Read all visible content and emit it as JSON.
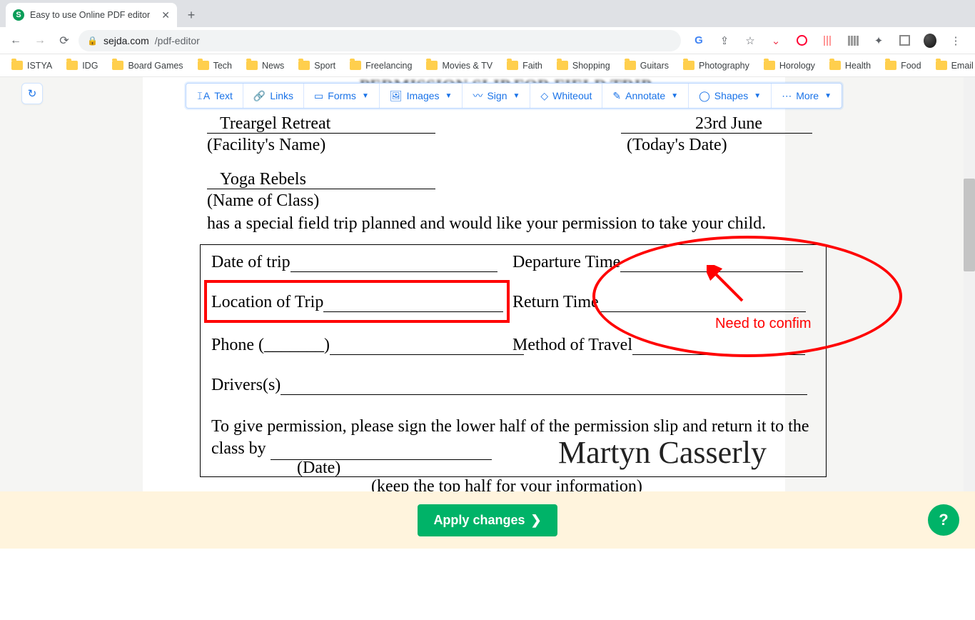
{
  "browser": {
    "tab_title": "Easy to use Online PDF editor",
    "url_host": "sejda.com",
    "url_path": "/pdf-editor",
    "bookmarks": [
      "ISTYA",
      "IDG",
      "Board Games",
      "Tech",
      "News",
      "Sport",
      "Freelancing",
      "Movies & TV",
      "Faith",
      "Shopping",
      "Guitars",
      "Photography",
      "Horology",
      "Health",
      "Food",
      "Email"
    ],
    "bm_more": "»"
  },
  "toolbar": {
    "text": "Text",
    "links": "Links",
    "forms": "Forms",
    "images": "Images",
    "sign": "Sign",
    "whiteout": "Whiteout",
    "annotate": "Annotate",
    "shapes": "Shapes",
    "more": "More"
  },
  "doc": {
    "title": "PERMISSION SLIP FOR FIELD TRIP",
    "facility_value": "Treargel Retreat",
    "facility_label": "(Facility's Name)",
    "date_value": "23rd June",
    "date_label": "(Today's Date)",
    "class_value": "Yoga Rebels",
    "class_label": "(Name of Class)",
    "body1": "has a special field trip planned and would like your permission to take your child.",
    "date_of_trip": "Date of trip",
    "departure": "Departure Time",
    "location": "Location of Trip",
    "return": "Return Time",
    "phone": "Phone (_______)",
    "method": "Method of Travel",
    "drivers": "Drivers(s)",
    "para2a": "To give permission, please sign the lower half of the permission slip and return it to the class by ",
    "date_lbl2": "(Date)",
    "keep": "(keep the top half for your information)",
    "signature": "Martyn Casserly"
  },
  "annot": {
    "text": "Need to confim"
  },
  "footer": {
    "apply": "Apply changes"
  }
}
